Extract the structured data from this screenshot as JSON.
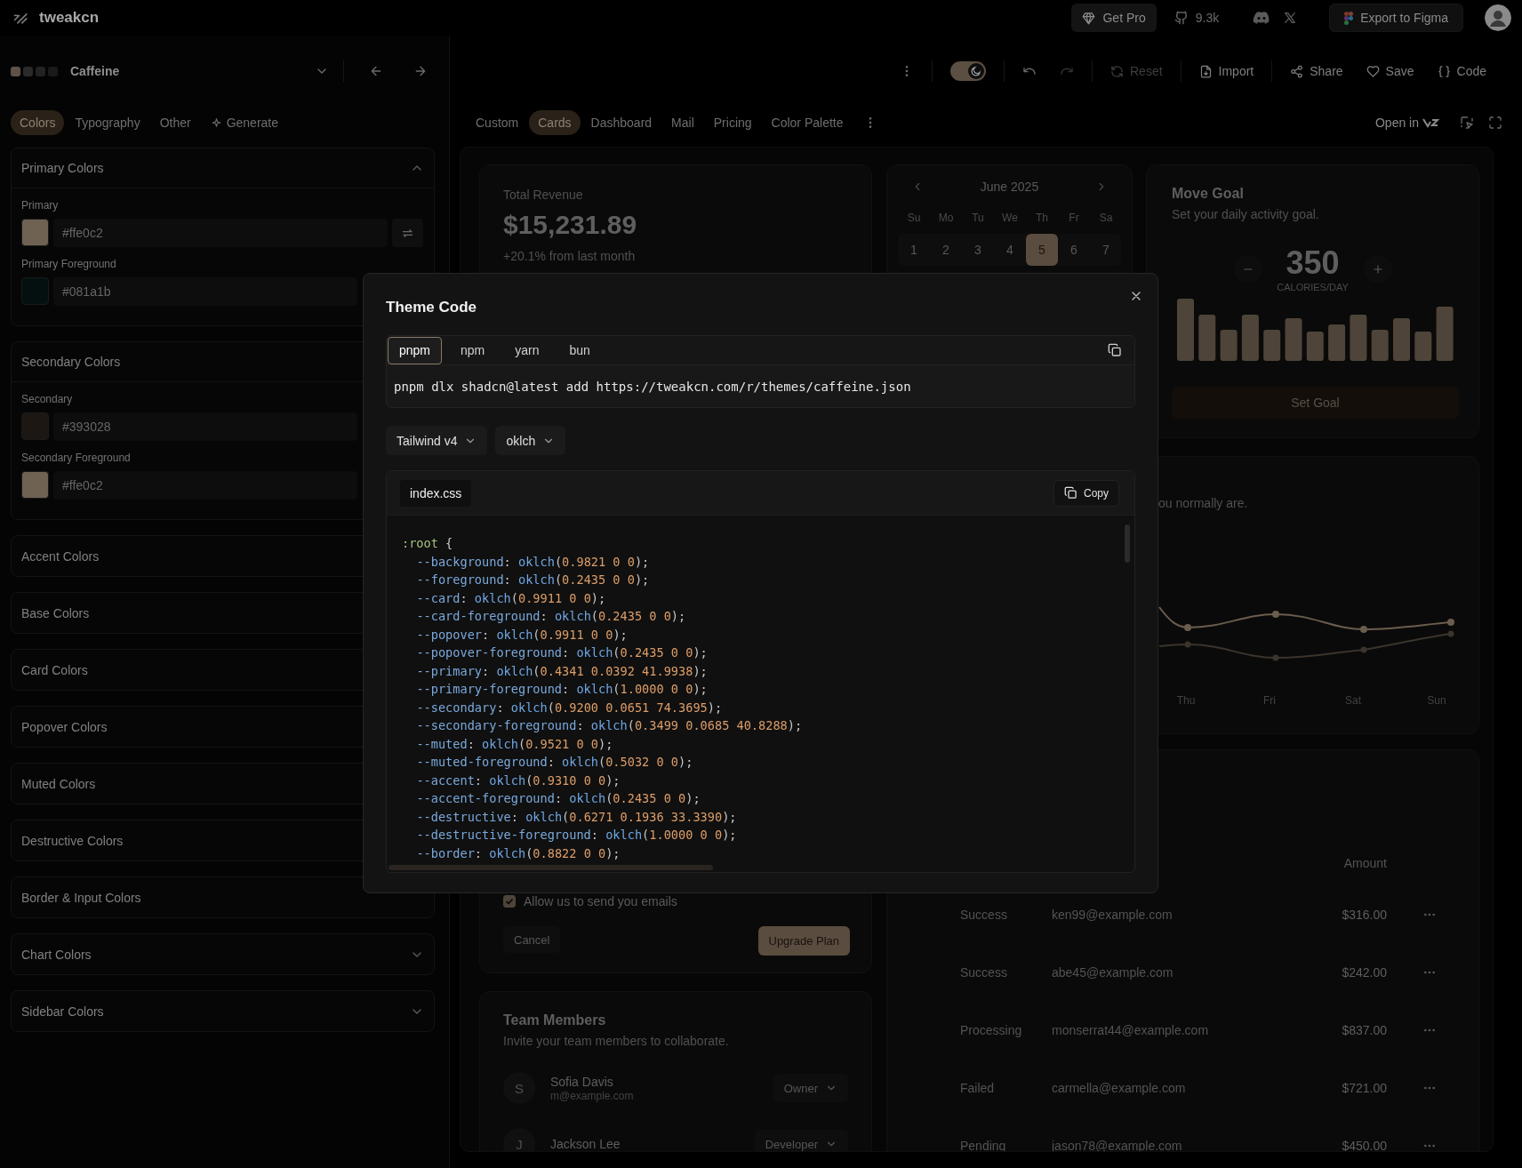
{
  "header": {
    "brand": "tweakcn",
    "get_pro": "Get Pro",
    "github_stars": "9.3k",
    "export_label": "Export to Figma"
  },
  "theme_bar": {
    "swatches": [
      {
        "color": "#5e5248"
      },
      {
        "color": "#2a2a2a"
      },
      {
        "color": "#222222"
      },
      {
        "color": "#1a1a1a"
      }
    ],
    "theme_name": "Caffeine"
  },
  "actions_bar": {
    "dark_mode": true,
    "history": [
      {
        "kind": "undo",
        "disabled": false
      },
      {
        "kind": "redo",
        "disabled": true
      }
    ],
    "actions": [
      {
        "kind": "reset",
        "label": "Reset",
        "disabled": true
      },
      {
        "kind": "import",
        "label": "Import",
        "disabled": false
      },
      {
        "kind": "share",
        "label": "Share",
        "disabled": false
      },
      {
        "kind": "save",
        "label": "Save",
        "disabled": false
      },
      {
        "kind": "code",
        "label": "Code",
        "disabled": false
      }
    ]
  },
  "editor_tabs": [
    {
      "label": "Colors",
      "selected": true,
      "kind": "tab"
    },
    {
      "label": "Typography",
      "selected": false,
      "kind": "tab"
    },
    {
      "label": "Other",
      "selected": false,
      "kind": "tab"
    },
    {
      "label": "Generate",
      "selected": false,
      "kind": "generate"
    }
  ],
  "color_sections": [
    {
      "title": "Primary Colors",
      "expanded": true,
      "fields": [
        {
          "label": "Primary",
          "value": "#ffe0c2",
          "color": "#6f6253",
          "kind": "swappable"
        },
        {
          "label": "Primary Foreground",
          "value": "#081a1b",
          "color": "#041010",
          "kind": "plain"
        }
      ]
    },
    {
      "title": "Secondary Colors",
      "fields": [
        {
          "label": "Secondary",
          "value": "#393028",
          "color": "#1c1713",
          "kind": "plain"
        },
        {
          "label": "Secondary Foreground",
          "value": "#ffe0c2",
          "color": "#6f6253",
          "kind": "plain"
        }
      ]
    },
    {
      "title": "Accent Colors"
    },
    {
      "title": "Base Colors"
    },
    {
      "title": "Card Colors"
    },
    {
      "title": "Popover Colors"
    },
    {
      "title": "Muted Colors"
    },
    {
      "title": "Destructive Colors"
    },
    {
      "title": "Border & Input Colors"
    },
    {
      "title": "Chart Colors",
      "expanded": false
    },
    {
      "title": "Sidebar Colors",
      "expanded": false
    }
  ],
  "preview_tabs": [
    {
      "label": "Custom",
      "selected": false
    },
    {
      "label": "Cards",
      "selected": true
    },
    {
      "label": "Dashboard",
      "selected": false
    },
    {
      "label": "Mail",
      "selected": false
    },
    {
      "label": "Pricing",
      "selected": false
    },
    {
      "label": "Color Palette",
      "selected": false
    }
  ],
  "open_in": "Open in",
  "preview": {
    "revenue": {
      "label": "Total Revenue",
      "value": "$15,231.89",
      "change": "+20.1% from last month"
    },
    "subscription": {
      "checkbox_label": "Allow us to send you emails",
      "checked": true,
      "cancel": "Cancel",
      "submit": "Upgrade Plan"
    },
    "team": {
      "title": "Team Members",
      "subtitle": "Invite your team members to collaborate.",
      "members": [
        {
          "initial": "S",
          "name": "Sofia Davis",
          "email": "m@example.com",
          "role": "Owner"
        },
        {
          "initial": "J",
          "name": "Jackson Lee",
          "role": "Developer"
        }
      ]
    },
    "calendar": {
      "month": "June 2025",
      "weekdays": [
        "Su",
        "Mo",
        "Tu",
        "We",
        "Th",
        "Fr",
        "Sa"
      ],
      "days": [
        {
          "label": "1",
          "selected": false
        },
        {
          "label": "2",
          "selected": false
        },
        {
          "label": "3",
          "selected": false
        },
        {
          "label": "4",
          "selected": false
        },
        {
          "label": "5",
          "selected": true
        },
        {
          "label": "6",
          "selected": false
        },
        {
          "label": "7",
          "selected": false
        }
      ]
    },
    "move_goal": {
      "title": "Move Goal",
      "subtitle": "Set your daily activity goal.",
      "value": "350",
      "unit": "CALORIES/DAY",
      "button": "Set Goal"
    },
    "activity": {
      "description_fragment": "ou normally are.",
      "x_labels": [
        "Thu",
        "Fri",
        "Sat",
        "Sun"
      ]
    },
    "payments": {
      "amount_header": "Amount",
      "rows": [
        {
          "status": "Success",
          "email": "ken99@example.com",
          "amount": "$316.00"
        },
        {
          "status": "Success",
          "email": "abe45@example.com",
          "amount": "$242.00"
        },
        {
          "status": "Processing",
          "email": "monserrat44@example.com",
          "amount": "$837.00"
        },
        {
          "status": "Failed",
          "email": "carmella@example.com",
          "amount": "$721.00"
        },
        {
          "status": "Pending",
          "email": "jason78@example.com",
          "amount": "$450.00"
        }
      ]
    }
  },
  "dialog": {
    "title": "Theme Code",
    "package_managers": [
      {
        "label": "pnpm",
        "selected": true
      },
      {
        "label": "npm",
        "selected": false
      },
      {
        "label": "yarn",
        "selected": false
      },
      {
        "label": "bun",
        "selected": false
      }
    ],
    "command": "pnpm dlx shadcn@latest add https://tweakcn.com/r/themes/caffeine.json",
    "selects": [
      "Tailwind v4",
      "oklch"
    ],
    "file_tab": "index.css",
    "copy_label": "Copy",
    "code_lines": [
      ":root {",
      "  --background: oklch(0.9821 0 0);",
      "  --foreground: oklch(0.2435 0 0);",
      "  --card: oklch(0.9911 0 0);",
      "  --card-foreground: oklch(0.2435 0 0);",
      "  --popover: oklch(0.9911 0 0);",
      "  --popover-foreground: oklch(0.2435 0 0);",
      "  --primary: oklch(0.4341 0.0392 41.9938);",
      "  --primary-foreground: oklch(1.0000 0 0);",
      "  --secondary: oklch(0.9200 0.0651 74.3695);",
      "  --secondary-foreground: oklch(0.3499 0.0685 40.8288);",
      "  --muted: oklch(0.9521 0 0);",
      "  --muted-foreground: oklch(0.5032 0 0);",
      "  --accent: oklch(0.9310 0 0);",
      "  --accent-foreground: oklch(0.2435 0 0);",
      "  --destructive: oklch(0.6271 0.1936 33.3390);",
      "  --destructive-foreground: oklch(1.0000 0 0);",
      "  --border: oklch(0.8822 0 0);"
    ]
  }
}
